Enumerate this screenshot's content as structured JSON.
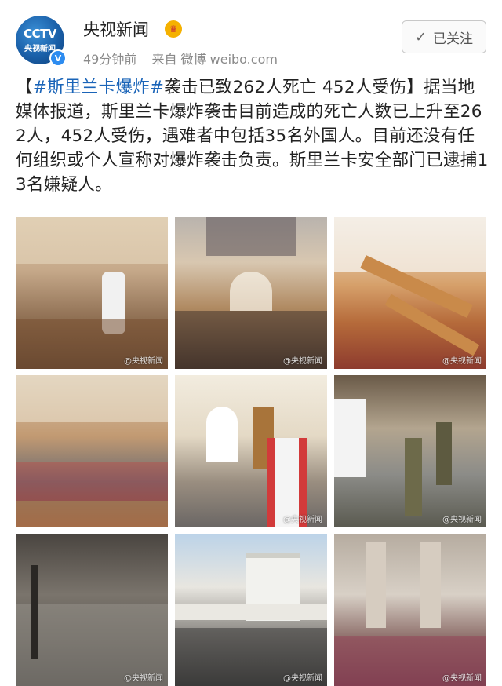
{
  "account": {
    "avatar_brand": "CCTV",
    "avatar_label": "央视新闻",
    "name": "央视新闻",
    "time": "49分钟前",
    "source": "来自 微博 weibo.com",
    "follow_label": "已关注"
  },
  "post": {
    "bracket_open": "【",
    "hashtag": "#斯里兰卡爆炸#",
    "headline": "袭击已致262人死亡 452人受伤",
    "bracket_close": "】",
    "body": "据当地媒体报道，斯里兰卡爆炸袭击目前造成的死亡人数已上升至262人，452人受伤，遇难者中包括35名外国人。目前还没有任何组织或个人宣称对爆炸袭击负责。斯里兰卡安全部门已逮捕13名嫌疑人。"
  },
  "photos": [
    {
      "watermark": "@央视新闻"
    },
    {
      "watermark": "@央视新闻"
    },
    {
      "watermark": "@央视新闻"
    },
    {
      "watermark": ""
    },
    {
      "watermark": "@央视新闻"
    },
    {
      "watermark": "@央视新闻"
    },
    {
      "watermark": "@央视新闻"
    },
    {
      "watermark": "@央视新闻"
    },
    {
      "watermark": "@央视新闻"
    }
  ],
  "icons": {
    "verified": "verified-badge-icon",
    "crown": "vip-crown-icon",
    "check": "check-icon"
  },
  "colors": {
    "hashtag": "#1a64b8",
    "verified": "#2d8cf0",
    "meta": "#8a8a8a"
  }
}
